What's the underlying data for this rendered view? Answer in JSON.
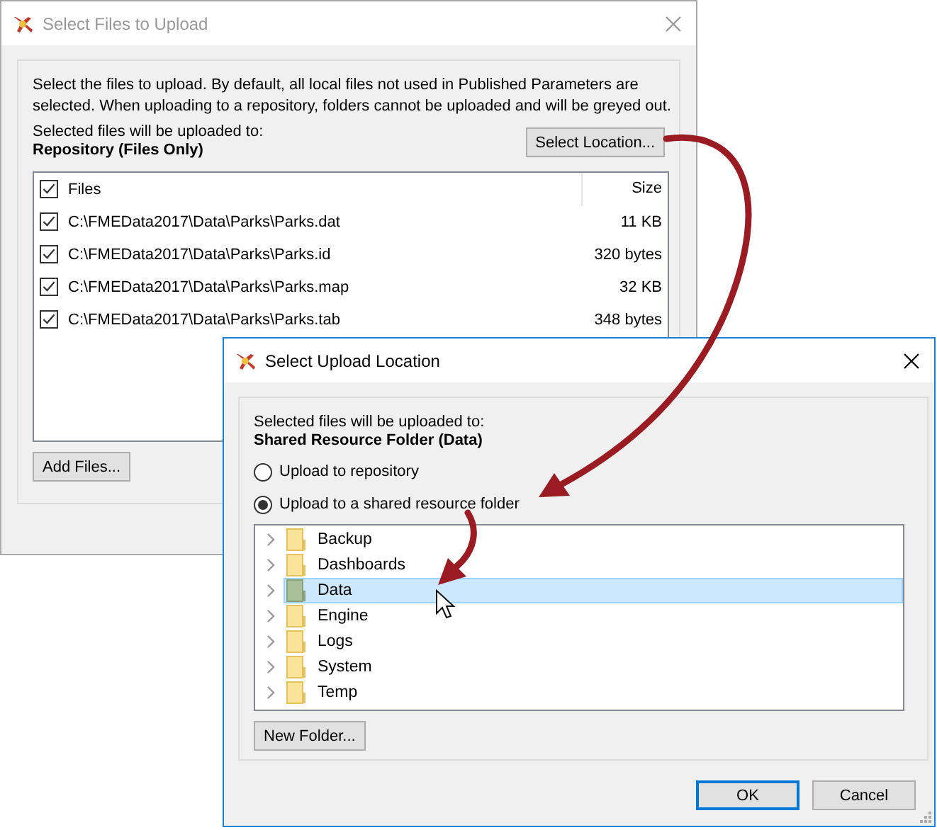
{
  "upload_dialog": {
    "title": "Select Files to Upload",
    "description": "Select the files to upload. By default, all local files not used in Published Parameters are selected. When uploading to a repository, folders cannot be uploaded and will be greyed out.",
    "destination_label": "Selected files will be uploaded to:",
    "destination_value": "Repository (Files Only)",
    "select_location_button": "Select Location...",
    "table": {
      "columns": [
        {
          "label": "Files",
          "checked": true
        },
        {
          "label": "Size"
        }
      ],
      "rows": [
        {
          "file": "C:\\FMEData2017\\Data\\Parks\\Parks.dat",
          "size": "11 KB",
          "checked": true
        },
        {
          "file": "C:\\FMEData2017\\Data\\Parks\\Parks.id",
          "size": "320 bytes",
          "checked": true
        },
        {
          "file": "C:\\FMEData2017\\Data\\Parks\\Parks.map",
          "size": "32 KB",
          "checked": true
        },
        {
          "file": "C:\\FMEData2017\\Data\\Parks\\Parks.tab",
          "size": "348 bytes",
          "checked": true
        }
      ]
    },
    "add_files_button": "Add Files..."
  },
  "location_dialog": {
    "title": "Select Upload Location",
    "destination_label": "Selected files will be uploaded to:",
    "destination_value": "Shared Resource Folder (Data)",
    "options": [
      {
        "label": "Upload to repository",
        "selected": false
      },
      {
        "label": "Upload to a shared resource folder",
        "selected": true
      }
    ],
    "folders": [
      {
        "name": "Backup",
        "selected": false
      },
      {
        "name": "Dashboards",
        "selected": false
      },
      {
        "name": "Data",
        "selected": true
      },
      {
        "name": "Engine",
        "selected": false
      },
      {
        "name": "Logs",
        "selected": false
      },
      {
        "name": "System",
        "selected": false
      },
      {
        "name": "Temp",
        "selected": false
      }
    ],
    "new_folder_button": "New Folder...",
    "buttons": [
      {
        "label": "OK",
        "default": true
      },
      {
        "label": "Cancel",
        "default": false
      }
    ]
  }
}
